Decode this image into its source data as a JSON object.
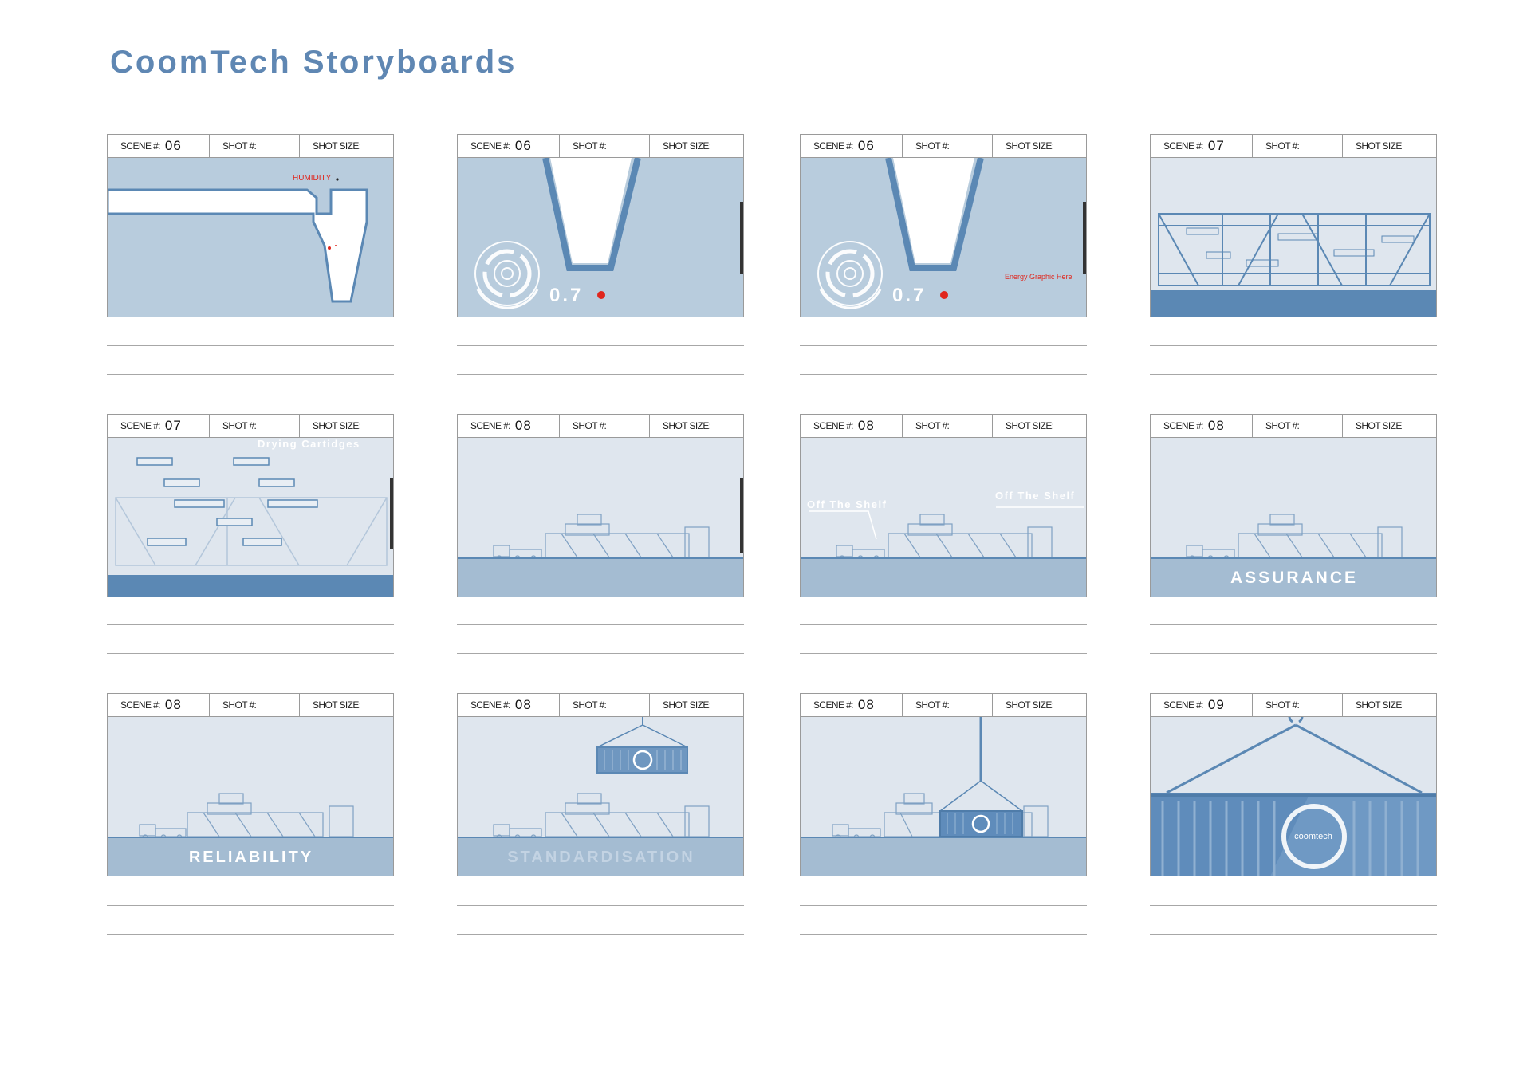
{
  "title": "CoomTech Storyboards",
  "labels": {
    "scene": "SCENE #:",
    "shot": "SHOT #:",
    "shot_size": "SHOT SIZE:",
    "shot_size_alt": "SHOT SIZE"
  },
  "panels": [
    {
      "scene": "06",
      "overlay": "HUMIDITY"
    },
    {
      "scene": "06",
      "value": "0.7"
    },
    {
      "scene": "06",
      "value": "0.7",
      "overlay": "Energy Graphic Here"
    },
    {
      "scene": "07"
    },
    {
      "scene": "07",
      "overlay": "Drying Cartidges"
    },
    {
      "scene": "08"
    },
    {
      "scene": "08",
      "overlay": "Off The Shelf",
      "overlay2": "Off The Shelf"
    },
    {
      "scene": "08",
      "caption": "ASSURANCE"
    },
    {
      "scene": "08",
      "caption": "RELIABILITY"
    },
    {
      "scene": "08",
      "caption": "STANDARDISATION"
    },
    {
      "scene": "08"
    },
    {
      "scene": "09",
      "logo": "coomtech"
    }
  ],
  "colors": {
    "title": "#5f87b3",
    "frame_blue": "#b8ccdd",
    "frame_light": "#dfe6ee",
    "ground": "#a4bcd2",
    "dark_ground": "#5b88b4",
    "line": "#5b88b4",
    "red": "#e0261d"
  }
}
